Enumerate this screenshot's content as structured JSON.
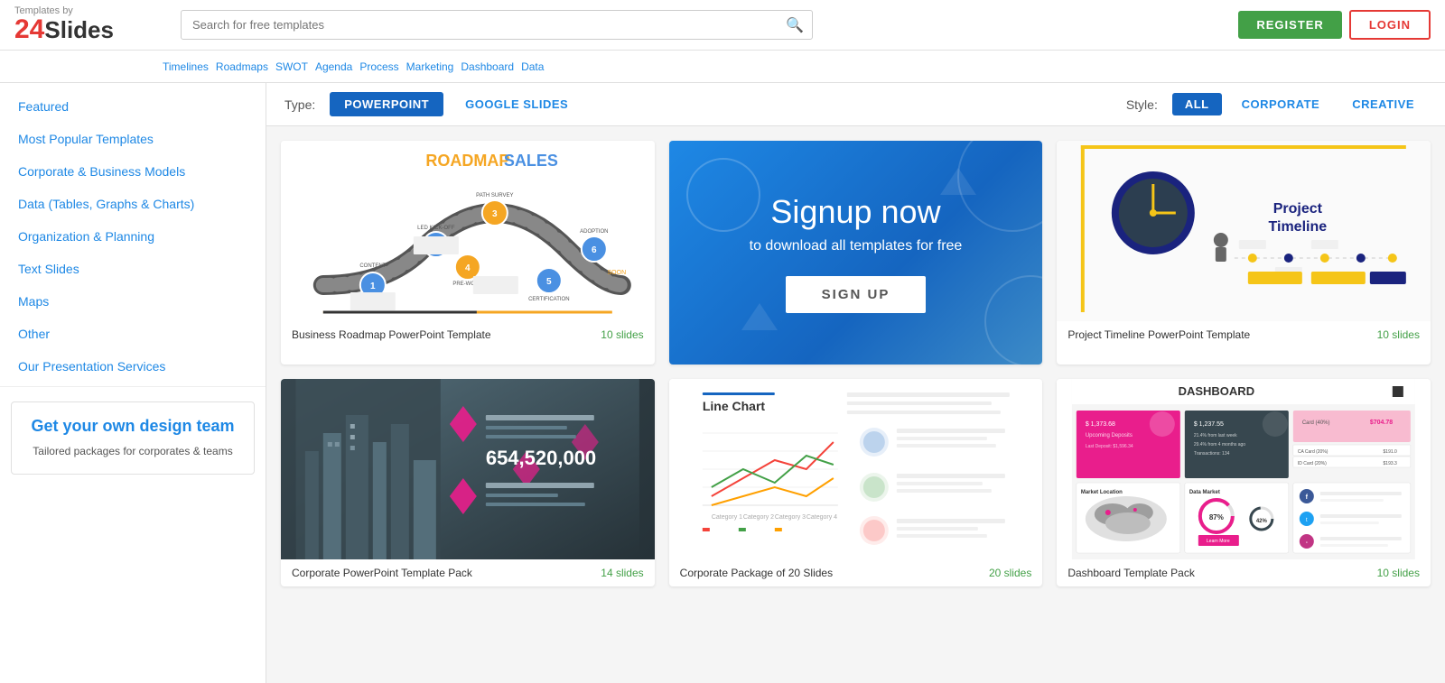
{
  "header": {
    "logo_by": "Templates by",
    "logo_number": "24",
    "logo_slides": "Slides",
    "search_placeholder": "Search for free templates",
    "register_label": "REGISTER",
    "login_label": "LOGIN"
  },
  "subheader": {
    "tags": [
      "Timelines",
      "Roadmaps",
      "SWOT",
      "Agenda",
      "Process",
      "Marketing",
      "Dashboard",
      "Data"
    ]
  },
  "sidebar": {
    "items": [
      {
        "label": "Featured",
        "type": "link",
        "active": true
      },
      {
        "label": "Most Popular Templates",
        "type": "link"
      },
      {
        "label": "Corporate & Business Models",
        "type": "link"
      },
      {
        "label": "Data (Tables, Graphs & Charts)",
        "type": "link"
      },
      {
        "label": "Organization & Planning",
        "type": "link"
      },
      {
        "label": "Text Slides",
        "type": "link"
      },
      {
        "label": "Maps",
        "type": "link"
      },
      {
        "label": "Other",
        "type": "link"
      },
      {
        "label": "Our Presentation Services",
        "type": "link"
      }
    ],
    "promo_title": "Get your own design team",
    "promo_subtitle": "Tailored packages for corporates & teams"
  },
  "filter_bar": {
    "type_label": "Type:",
    "types": [
      {
        "label": "POWERPOINT",
        "active": true
      },
      {
        "label": "GOOGLE SLIDES",
        "active": false
      }
    ],
    "style_label": "Style:",
    "styles": [
      {
        "label": "ALL",
        "active": true
      },
      {
        "label": "CORPORATE",
        "active": false
      },
      {
        "label": "CREATIVE",
        "active": false
      }
    ]
  },
  "templates": [
    {
      "name": "Business Roadmap PowerPoint Template",
      "slides": "10 slides",
      "type": "roadmap"
    },
    {
      "name": "Signup Now",
      "subtitle": "to download all templates for free",
      "cta": "SIGN UP",
      "type": "signup"
    },
    {
      "name": "Project Timeline PowerPoint Template",
      "slides": "10 slides",
      "type": "timeline"
    },
    {
      "name": "Corporate PowerPoint Template Pack",
      "slides": "14 slides",
      "type": "corporate"
    },
    {
      "name": "Corporate Package of 20 Slides",
      "slides": "20 slides",
      "type": "linechart"
    },
    {
      "name": "Dashboard Template Pack",
      "slides": "10 slides",
      "type": "dashboard"
    }
  ]
}
